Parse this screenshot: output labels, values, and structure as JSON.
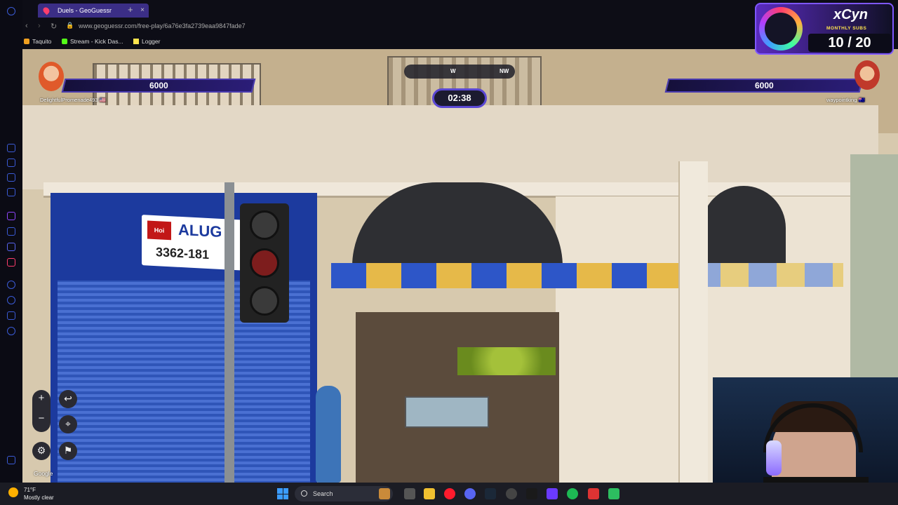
{
  "browser": {
    "tab_title": "Duels - GeoGuessr",
    "url": "www.geoguessr.com/free-play/6a76e3fa2739eaa9847fade7",
    "bookmarks": [
      {
        "label": "Taquito",
        "icon": "taquito-icon",
        "color": "#f0a020"
      },
      {
        "label": "Stream - Kick Das...",
        "icon": "kick-icon",
        "color": "#53fc18"
      },
      {
        "label": "Logger",
        "icon": "lightning-icon",
        "color": "#ffe44d"
      }
    ]
  },
  "game": {
    "player_left": {
      "score": "6000",
      "name": "DelightfulPromenade493 🇺🇸"
    },
    "player_right": {
      "score": "6000",
      "name": "waypointking 🇦🇺"
    },
    "compass": {
      "left": "W",
      "right": "NW"
    },
    "timer": "02:38",
    "attribution": "Google"
  },
  "scene": {
    "sign_text": "ALUG",
    "sign_phone": "3362-181",
    "sign_logo": "Hoi"
  },
  "subgoal": {
    "brand": "xCyn",
    "label": "MONTHLY SUBS",
    "count": "10 / 20"
  },
  "taskbar": {
    "weather_temp": "71°F",
    "weather_cond": "Mostly clear",
    "search_placeholder": "Search"
  },
  "colors": {
    "accent": "#5b48d4",
    "score_bg": "#15103a"
  }
}
